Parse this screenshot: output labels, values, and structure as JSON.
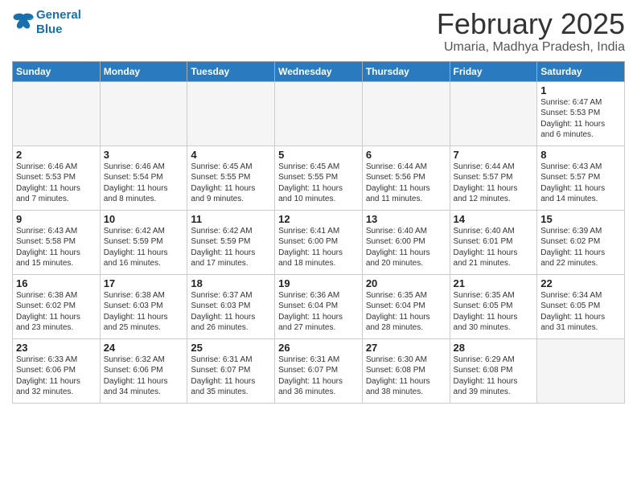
{
  "header": {
    "logo_line1": "General",
    "logo_line2": "Blue",
    "title": "February 2025",
    "subtitle": "Umaria, Madhya Pradesh, India"
  },
  "weekdays": [
    "Sunday",
    "Monday",
    "Tuesday",
    "Wednesday",
    "Thursday",
    "Friday",
    "Saturday"
  ],
  "weeks": [
    [
      {
        "day": "",
        "info": ""
      },
      {
        "day": "",
        "info": ""
      },
      {
        "day": "",
        "info": ""
      },
      {
        "day": "",
        "info": ""
      },
      {
        "day": "",
        "info": ""
      },
      {
        "day": "",
        "info": ""
      },
      {
        "day": "1",
        "info": "Sunrise: 6:47 AM\nSunset: 5:53 PM\nDaylight: 11 hours\nand 6 minutes."
      }
    ],
    [
      {
        "day": "2",
        "info": "Sunrise: 6:46 AM\nSunset: 5:53 PM\nDaylight: 11 hours\nand 7 minutes."
      },
      {
        "day": "3",
        "info": "Sunrise: 6:46 AM\nSunset: 5:54 PM\nDaylight: 11 hours\nand 8 minutes."
      },
      {
        "day": "4",
        "info": "Sunrise: 6:45 AM\nSunset: 5:55 PM\nDaylight: 11 hours\nand 9 minutes."
      },
      {
        "day": "5",
        "info": "Sunrise: 6:45 AM\nSunset: 5:55 PM\nDaylight: 11 hours\nand 10 minutes."
      },
      {
        "day": "6",
        "info": "Sunrise: 6:44 AM\nSunset: 5:56 PM\nDaylight: 11 hours\nand 11 minutes."
      },
      {
        "day": "7",
        "info": "Sunrise: 6:44 AM\nSunset: 5:57 PM\nDaylight: 11 hours\nand 12 minutes."
      },
      {
        "day": "8",
        "info": "Sunrise: 6:43 AM\nSunset: 5:57 PM\nDaylight: 11 hours\nand 14 minutes."
      }
    ],
    [
      {
        "day": "9",
        "info": "Sunrise: 6:43 AM\nSunset: 5:58 PM\nDaylight: 11 hours\nand 15 minutes."
      },
      {
        "day": "10",
        "info": "Sunrise: 6:42 AM\nSunset: 5:59 PM\nDaylight: 11 hours\nand 16 minutes."
      },
      {
        "day": "11",
        "info": "Sunrise: 6:42 AM\nSunset: 5:59 PM\nDaylight: 11 hours\nand 17 minutes."
      },
      {
        "day": "12",
        "info": "Sunrise: 6:41 AM\nSunset: 6:00 PM\nDaylight: 11 hours\nand 18 minutes."
      },
      {
        "day": "13",
        "info": "Sunrise: 6:40 AM\nSunset: 6:00 PM\nDaylight: 11 hours\nand 20 minutes."
      },
      {
        "day": "14",
        "info": "Sunrise: 6:40 AM\nSunset: 6:01 PM\nDaylight: 11 hours\nand 21 minutes."
      },
      {
        "day": "15",
        "info": "Sunrise: 6:39 AM\nSunset: 6:02 PM\nDaylight: 11 hours\nand 22 minutes."
      }
    ],
    [
      {
        "day": "16",
        "info": "Sunrise: 6:38 AM\nSunset: 6:02 PM\nDaylight: 11 hours\nand 23 minutes."
      },
      {
        "day": "17",
        "info": "Sunrise: 6:38 AM\nSunset: 6:03 PM\nDaylight: 11 hours\nand 25 minutes."
      },
      {
        "day": "18",
        "info": "Sunrise: 6:37 AM\nSunset: 6:03 PM\nDaylight: 11 hours\nand 26 minutes."
      },
      {
        "day": "19",
        "info": "Sunrise: 6:36 AM\nSunset: 6:04 PM\nDaylight: 11 hours\nand 27 minutes."
      },
      {
        "day": "20",
        "info": "Sunrise: 6:35 AM\nSunset: 6:04 PM\nDaylight: 11 hours\nand 28 minutes."
      },
      {
        "day": "21",
        "info": "Sunrise: 6:35 AM\nSunset: 6:05 PM\nDaylight: 11 hours\nand 30 minutes."
      },
      {
        "day": "22",
        "info": "Sunrise: 6:34 AM\nSunset: 6:05 PM\nDaylight: 11 hours\nand 31 minutes."
      }
    ],
    [
      {
        "day": "23",
        "info": "Sunrise: 6:33 AM\nSunset: 6:06 PM\nDaylight: 11 hours\nand 32 minutes."
      },
      {
        "day": "24",
        "info": "Sunrise: 6:32 AM\nSunset: 6:06 PM\nDaylight: 11 hours\nand 34 minutes."
      },
      {
        "day": "25",
        "info": "Sunrise: 6:31 AM\nSunset: 6:07 PM\nDaylight: 11 hours\nand 35 minutes."
      },
      {
        "day": "26",
        "info": "Sunrise: 6:31 AM\nSunset: 6:07 PM\nDaylight: 11 hours\nand 36 minutes."
      },
      {
        "day": "27",
        "info": "Sunrise: 6:30 AM\nSunset: 6:08 PM\nDaylight: 11 hours\nand 38 minutes."
      },
      {
        "day": "28",
        "info": "Sunrise: 6:29 AM\nSunset: 6:08 PM\nDaylight: 11 hours\nand 39 minutes."
      },
      {
        "day": "",
        "info": ""
      }
    ]
  ]
}
